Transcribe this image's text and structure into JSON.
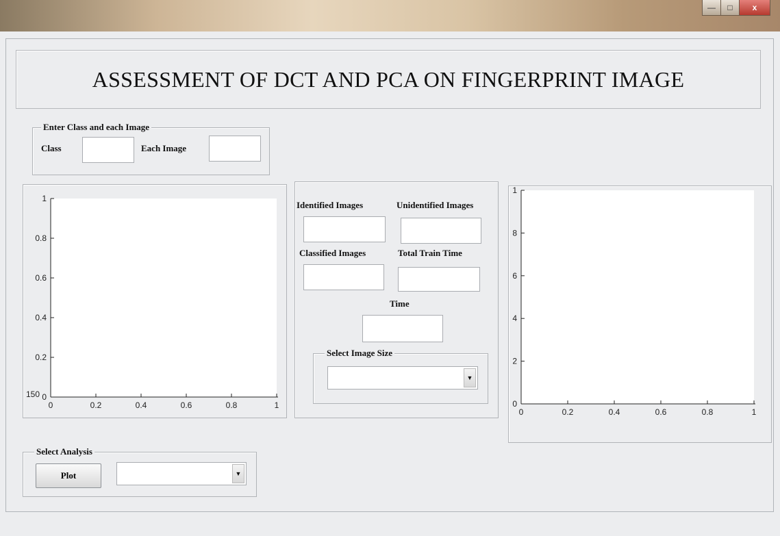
{
  "window": {
    "controls": {
      "minimize": "—",
      "maximize": "□",
      "close": "x"
    }
  },
  "header": {
    "title": "ASSESSMENT OF DCT AND PCA ON FINGERPRINT IMAGE"
  },
  "input_group": {
    "legend": "Enter Class and each Image",
    "class_label": "Class",
    "class_value": "",
    "each_image_label": "Each Image",
    "each_image_value": ""
  },
  "results": {
    "identified_label": "Identified Images",
    "identified_value": "",
    "unidentified_label": "Unidentified Images",
    "unidentified_value": "",
    "classified_label": "Classified Images",
    "classified_value": "",
    "train_time_label": "Total Train Time",
    "train_time_value": "",
    "time_label": "Time",
    "time_value": "",
    "image_size_legend": "Select Image Size",
    "image_size_selected": ""
  },
  "analysis": {
    "legend": "Select Analysis",
    "plot_button": "Plot",
    "selected": ""
  },
  "left_axes": {
    "stray_label": "150",
    "y_ticks": [
      "0",
      "0.2",
      "0.4",
      "0.6",
      "0.8",
      "1"
    ],
    "x_ticks": [
      "0",
      "0.2",
      "0.4",
      "0.6",
      "0.8",
      "1"
    ]
  },
  "chart_data": [
    {
      "type": "line",
      "series": [],
      "xlim": [
        0,
        1
      ],
      "ylim": [
        0,
        1
      ],
      "x_ticks": [
        "0",
        "0.2",
        "0.4",
        "0.6",
        "0.8",
        "1"
      ],
      "y_ticks": [
        "0",
        "0.2",
        "0.4",
        "0.6",
        "0.8",
        "1"
      ]
    },
    {
      "type": "line",
      "series": [],
      "xlim": [
        0,
        1
      ],
      "ylim": [
        0,
        1
      ],
      "x_ticks": [
        "0",
        "0.2",
        "0.4",
        "0.6",
        "0.8",
        "1"
      ],
      "y_ticks": [
        "0",
        "2",
        "4",
        "6",
        "8",
        "1"
      ]
    }
  ],
  "right_axes": {
    "y_ticks": [
      "0",
      "2",
      "4",
      "6",
      "8",
      "1"
    ],
    "x_ticks": [
      "0",
      "0.2",
      "0.4",
      "0.6",
      "0.8",
      "1"
    ]
  }
}
